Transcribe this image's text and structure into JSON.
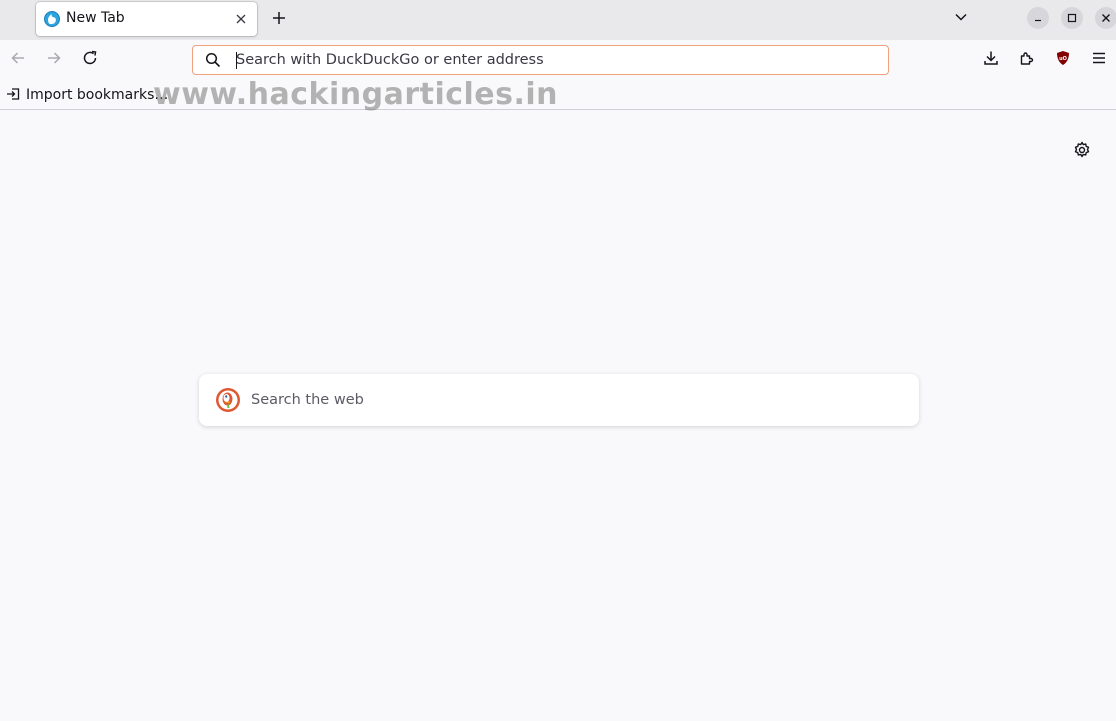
{
  "tabs": [
    {
      "title": "New Tab",
      "active": true
    }
  ],
  "window_controls": {
    "minimize": "–",
    "maximize": "□",
    "close": "×"
  },
  "navbar": {
    "url_placeholder": "Search with DuckDuckGo or enter address",
    "url_value": ""
  },
  "bookmarks": {
    "import_label": "Import bookmarks…"
  },
  "watermark": "www.hackingarticles.in",
  "content": {
    "search_placeholder": "Search the web"
  },
  "colors": {
    "urlbar_focus_border": "#f0a27c",
    "page_bg": "#f9f9fb",
    "tabstrip_bg": "#e9e9eb",
    "ublock_red": "#800000",
    "ddg_orange": "#de5833"
  },
  "icons": [
    "firefox-favicon-icon",
    "close-icon",
    "plus-icon",
    "chevron-down-icon",
    "back-arrow-icon",
    "forward-arrow-icon",
    "reload-icon",
    "search-icon",
    "download-icon",
    "extensions-icon",
    "ublock-icon",
    "hamburger-menu-icon",
    "import-icon",
    "gear-icon",
    "duckduckgo-icon"
  ]
}
